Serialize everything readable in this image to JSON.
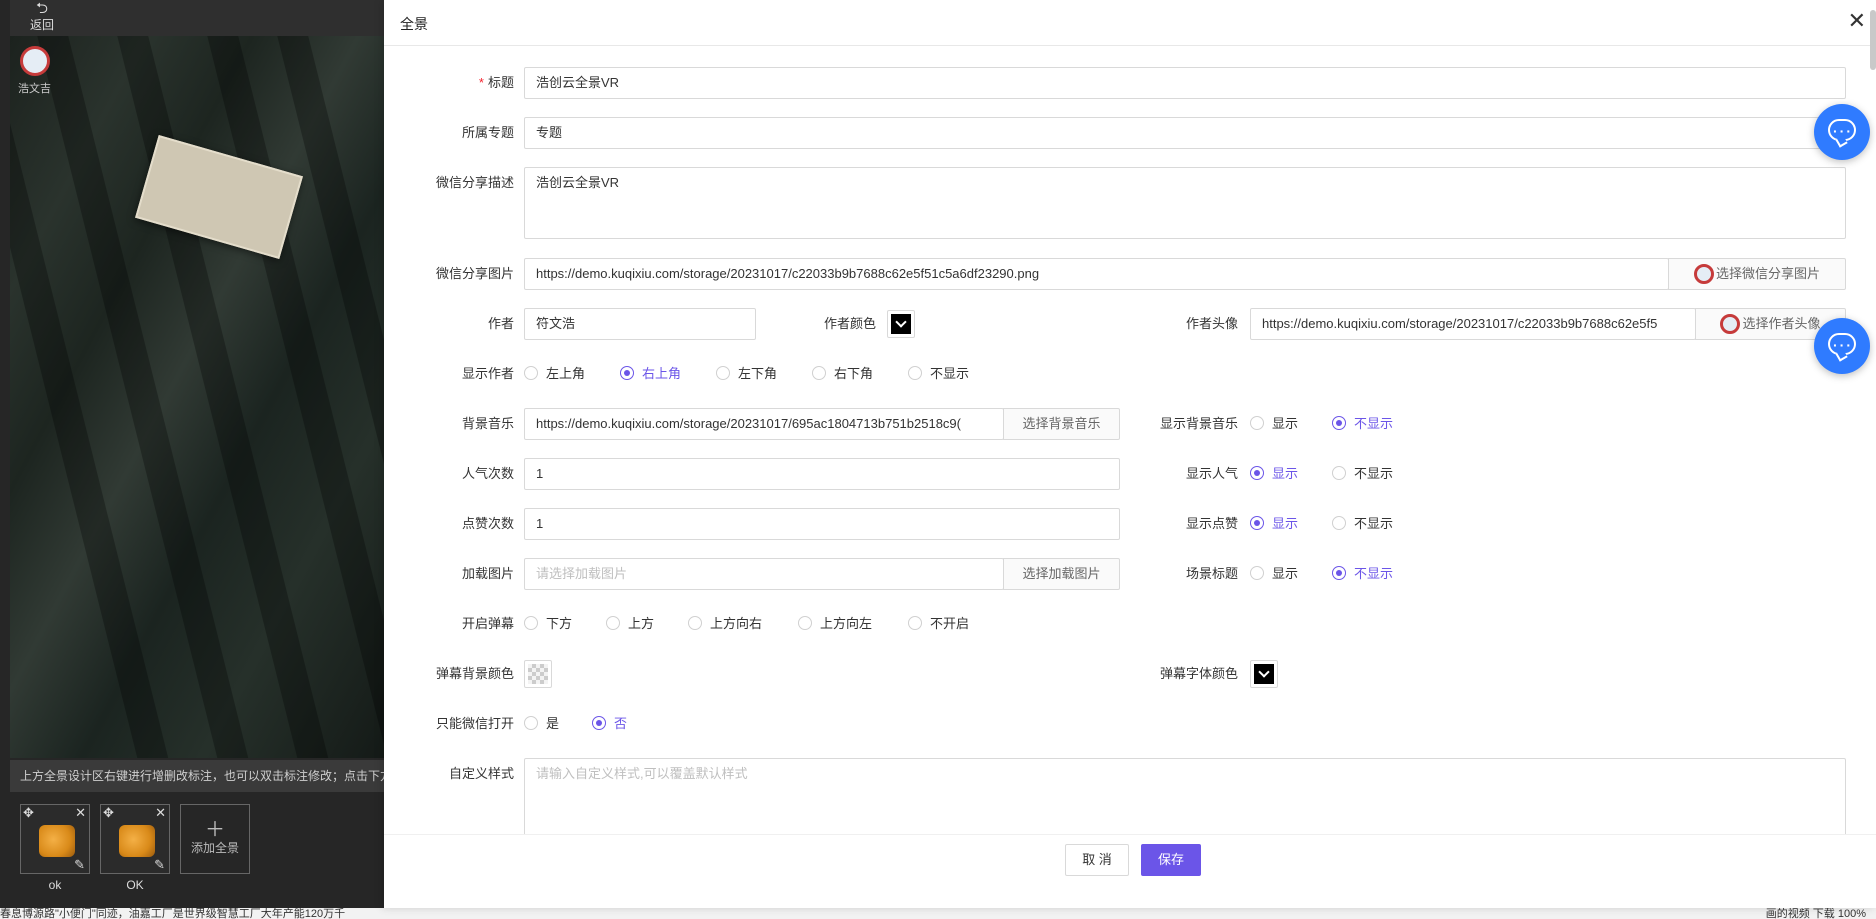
{
  "background_app": {
    "back_label": "返回",
    "logo_text": "浩文吉",
    "hint_text": "上方全景设计区右键进行增删改标注，也可以双击标注修改；点击下方",
    "scenes": [
      {
        "label": "ok"
      },
      {
        "label": "OK"
      }
    ],
    "add_scene_label": "添加全景",
    "status_left": "春息博源路\"小便门\"同迹，油嘉工厂是世界级智慧工厂大年产能120万千",
    "status_right": "画的视频  下载  100%"
  },
  "dialog": {
    "title": "全景",
    "fields": {
      "title": {
        "label": "标题",
        "required": true,
        "value": "浩创云全景VR"
      },
      "topic": {
        "label": "所属专题",
        "value": "专题"
      },
      "wechat_desc": {
        "label": "微信分享描述",
        "value": "浩创云全景VR"
      },
      "wechat_image": {
        "label": "微信分享图片",
        "value": "https://demo.kuqixiu.com/storage/20231017/c22033b9b7688c62e5f51c5a6df23290.png",
        "button": "选择微信分享图片"
      },
      "author": {
        "label": "作者",
        "value": "符文浩"
      },
      "author_color": {
        "label": "作者颜色",
        "color": "#000000"
      },
      "author_avatar": {
        "label": "作者头像",
        "value": "https://demo.kuqixiu.com/storage/20231017/c22033b9b7688c62e5f5",
        "button": "选择作者头像"
      },
      "show_author": {
        "label": "显示作者",
        "options": [
          "左上角",
          "右上角",
          "左下角",
          "右下角",
          "不显示"
        ],
        "selected": "右上角"
      },
      "bg_music": {
        "label": "背景音乐",
        "value": "https://demo.kuqixiu.com/storage/20231017/695ac1804713b751b2518c9(",
        "button": "选择背景音乐"
      },
      "show_bg_music": {
        "label": "显示背景音乐",
        "options": [
          "显示",
          "不显示"
        ],
        "selected": "不显示"
      },
      "popularity": {
        "label": "人气次数",
        "value": "1"
      },
      "show_popularity": {
        "label": "显示人气",
        "options": [
          "显示",
          "不显示"
        ],
        "selected": "显示"
      },
      "likes": {
        "label": "点赞次数",
        "value": "1"
      },
      "show_likes": {
        "label": "显示点赞",
        "options": [
          "显示",
          "不显示"
        ],
        "selected": "显示"
      },
      "loading_image": {
        "label": "加载图片",
        "placeholder": "请选择加载图片",
        "button": "选择加载图片"
      },
      "scene_title": {
        "label": "场景标题",
        "options": [
          "显示",
          "不显示"
        ],
        "selected": "不显示"
      },
      "danmaku": {
        "label": "开启弹幕",
        "options": [
          "下方",
          "上方",
          "上方向右",
          "上方向左",
          "不开启"
        ],
        "selected": ""
      },
      "danmaku_bg_color": {
        "label": "弹幕背景颜色",
        "color": "transparent"
      },
      "danmaku_font_color": {
        "label": "弹幕字体颜色",
        "color": "#000000"
      },
      "wechat_only": {
        "label": "只能微信打开",
        "options": [
          "是",
          "否"
        ],
        "selected": "否"
      },
      "custom_style": {
        "label": "自定义样式",
        "placeholder": "请输入自定义样式,可以覆盖默认样式"
      }
    },
    "cancel_label": "取 消",
    "save_label": "保存"
  },
  "colors": {
    "accent": "#6b55e8",
    "chat_fab": "#2f7bff"
  }
}
